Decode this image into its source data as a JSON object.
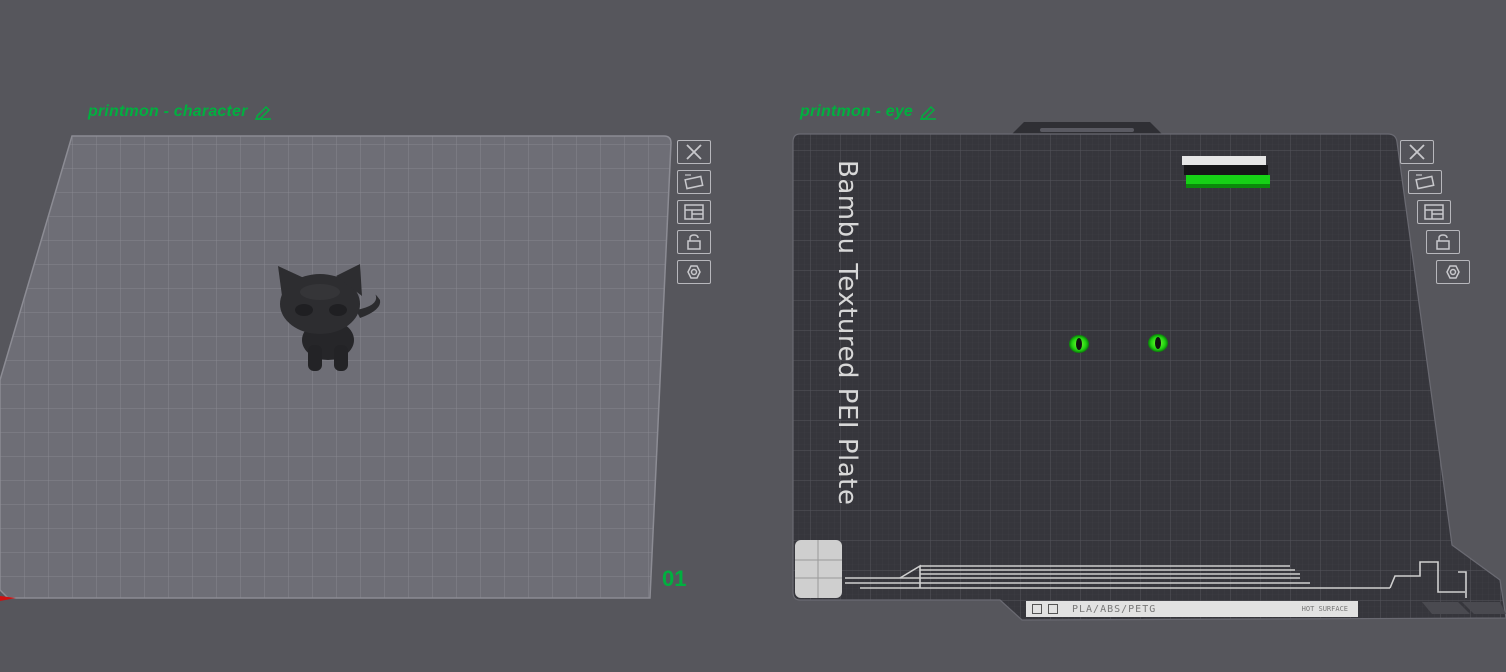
{
  "plates": [
    {
      "title": "printmon - character",
      "number": "01",
      "toolbar": [
        "close-icon",
        "auto-orient-icon",
        "arrange-icon",
        "lock-icon",
        "settings-icon"
      ]
    },
    {
      "title": "printmon - eye",
      "bed_label": "Bambu Textured PEI Plate",
      "strip_material": "PLA/ABS/PETG",
      "strip_hot": "HOT SURFACE",
      "toolbar": [
        "close-icon",
        "auto-orient-icon",
        "arrange-icon",
        "lock-icon",
        "settings-icon"
      ]
    }
  ],
  "colors": {
    "background": "#56565c",
    "accent_green": "#00b03f",
    "plate_light": "#6e6e76",
    "plate_dark": "#36363c"
  }
}
